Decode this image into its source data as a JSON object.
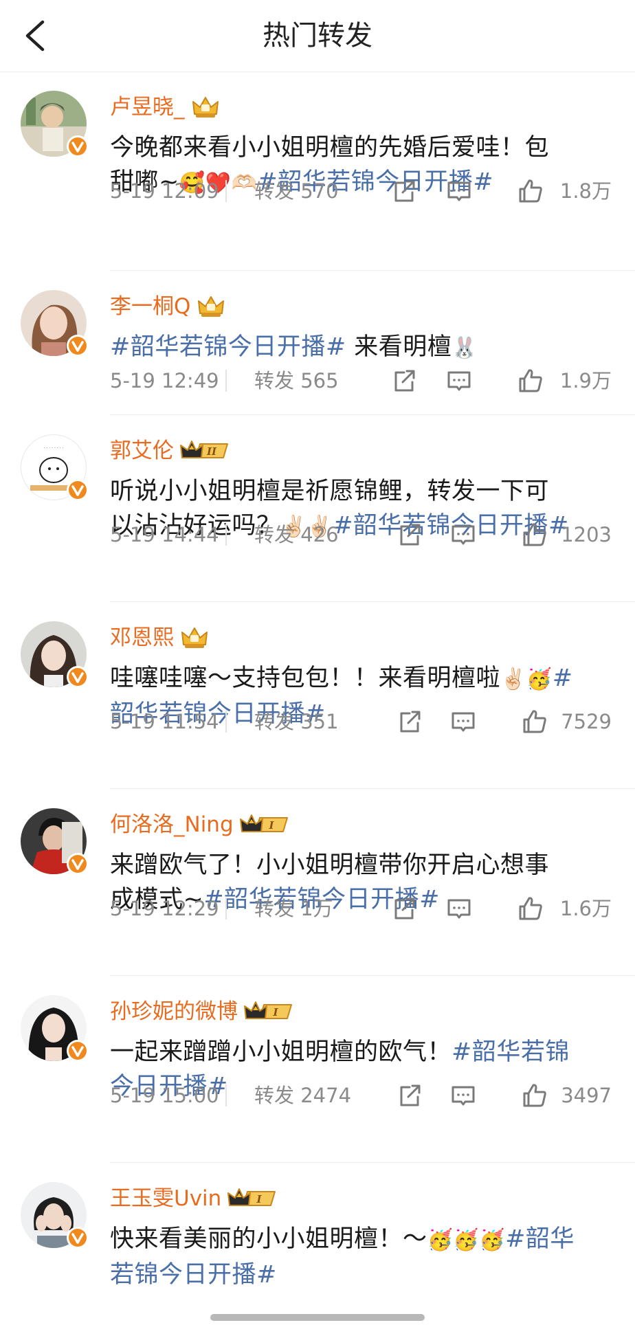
{
  "header": {
    "title": "热门转发",
    "back_icon": "chevron-left-icon"
  },
  "colors": {
    "username": "#e86b1f",
    "hashtag": "#4a6fa8",
    "meta_text": "#8a8a8a",
    "verified_badge": "#f08a1e"
  },
  "posts": [
    {
      "username": "卢昱晓_",
      "badge": "crown",
      "content_line1": "今晚都来看小小姐明檀的先婚后爱哇！包",
      "content_line2_text": "甜嘟~",
      "content_line2_emoji": "🥰❤️🫶🏻",
      "hashtag": "#韶华若锦今日开播#",
      "date": "5-19 12:09",
      "repost": "转发 570",
      "likes": "1.8万"
    },
    {
      "username": "李一桐Q",
      "badge": "crown",
      "hashtag": "#韶华若锦今日开播#",
      "content_after_tag": " 来看明檀",
      "emoji": "🐰",
      "date": "5-19 12:49",
      "repost": "转发 565",
      "likes": "1.9万"
    },
    {
      "username": "郭艾伦",
      "badge": "crown-level-II",
      "badge_level": "II",
      "content_line1": "听说小小姐明檀是祈愿锦鲤，转发一下可",
      "content_line2_text": "以沾沾好运吗？",
      "emoji": "✌🏻✌🏻",
      "hashtag": "#韶华若锦今日开播#",
      "date": "5-19 14:44",
      "repost": "转发 426",
      "likes": "1203"
    },
    {
      "username": "邓恩熙",
      "badge": "crown",
      "content_line1_text": "哇噻哇噻～支持包包！！来看明檀啦",
      "emoji": "✌🏻🥳",
      "hashtag_part1": "#",
      "hashtag_part2": "韶华若锦今日开播#",
      "date": "5-19 11:54",
      "repost": "转发 351",
      "likes": "7529"
    },
    {
      "username": "何洛洛_Ning",
      "badge": "crown-level-I",
      "badge_level": "I",
      "content_line1": "来蹭欧气了！小小姐明檀带你开启心想事",
      "content_line2_text": "成模式~",
      "hashtag": "#韶华若锦今日开播#",
      "date": "5-19 12:29",
      "repost": "转发 1万",
      "likes": "1.6万"
    },
    {
      "username": "孙珍妮的微博",
      "badge": "crown-level-I",
      "badge_level": "I",
      "content_line1_text": "一起来蹭蹭小小姐明檀的欧气！",
      "hashtag_part1": "#韶华若锦",
      "hashtag_part2": "今日开播#",
      "date": "5-19 15:00",
      "repost": "转发 2474",
      "likes": "3497"
    },
    {
      "username": "王玉雯Uvin",
      "badge": "crown-level-I",
      "badge_level": "I",
      "content_line1_text": "快来看美丽的小小姐明檀！～",
      "emoji": "🥳🥳🥳",
      "hashtag_part1": "#韶华",
      "hashtag_part2": "若锦今日开播#"
    }
  ]
}
